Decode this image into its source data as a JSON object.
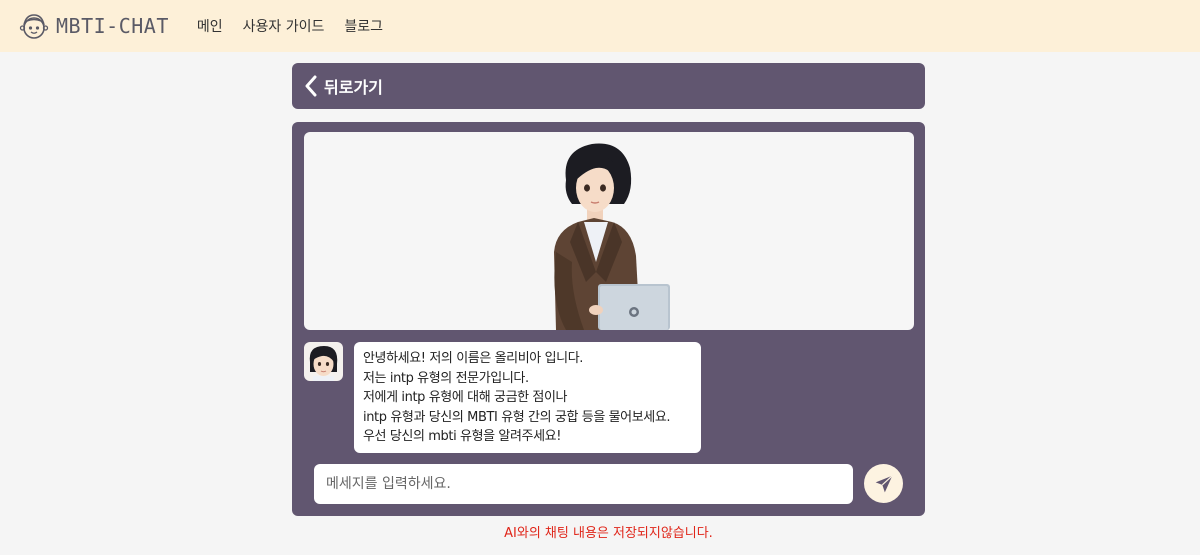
{
  "header": {
    "logo_text": "MBTI-CHAT",
    "nav": [
      "메인",
      "사용자 가이드",
      "블로그"
    ]
  },
  "back": {
    "label": "뒤로가기"
  },
  "chat": {
    "bot_message_lines": [
      "안녕하세요! 저의 이름은 올리비아 입니다.",
      "저는 intp 유형의 전문가입니다.",
      "저에게 intp 유형에 대해 궁금한 점이나",
      "intp 유형과 당신의 MBTI 유형 간의 궁합 등을 물어보세요.",
      "우선 당신의 mbti 유형을 알려주세요!"
    ],
    "input_placeholder": "메세지를 입력하세요.",
    "input_value": ""
  },
  "notice": "AI와의 채팅 내용은 저장되지않습니다.",
  "colors": {
    "topbar": "#fdf0d8",
    "panel": "#615670",
    "notice": "#e0261a",
    "send_button": "#fdf3e1"
  },
  "icons": {
    "logo": "cartoon-face-icon",
    "back": "chevron-left-icon",
    "send": "paper-plane-icon"
  }
}
